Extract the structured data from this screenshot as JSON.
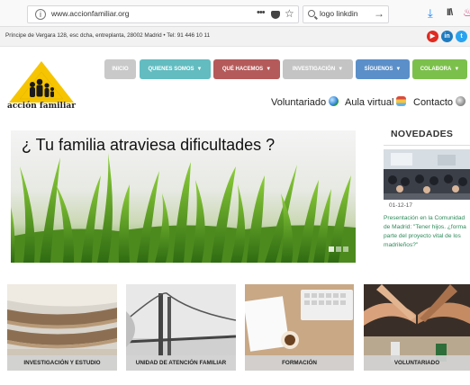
{
  "browser": {
    "url": "www.accionfamiliar.org",
    "more": "•••",
    "search_value": "logo linkdin",
    "go": "→",
    "download": "⤓",
    "library": "II\\",
    "ext": "♨"
  },
  "topbar": {
    "address": "Príncipe de Vergara 128, esc dcha, entreplanta, 28002 Madrid • Tel: 91 446 10 11",
    "social": [
      {
        "name": "youtube",
        "glyph": "▶",
        "color": "#e02a20"
      },
      {
        "name": "linkedin",
        "glyph": "in",
        "color": "#1f7bc0"
      },
      {
        "name": "twitter",
        "glyph": "t",
        "color": "#2aa3ef"
      }
    ]
  },
  "logo": {
    "text": "acción familiar",
    "color": "#f6c400"
  },
  "nav": [
    {
      "label": "INICIO",
      "color": "#c9c9c9",
      "has_caret": false
    },
    {
      "label": "QUIENES SOMOS",
      "color": "#62bcc0",
      "has_caret": true
    },
    {
      "label": "QUÉ HACEMOS",
      "color": "#b55a5a",
      "has_caret": true
    },
    {
      "label": "INVESTIGACIÓN",
      "color": "#c4c4c4",
      "has_caret": true
    },
    {
      "label": "SÍGUENOS",
      "color": "#5b8fc9",
      "has_caret": true
    },
    {
      "label": "COLABORA",
      "color": "#7cc04c",
      "has_caret": true
    }
  ],
  "sublinks": [
    {
      "label": "Voluntariado",
      "icon": "globe-icon"
    },
    {
      "label": "Aula virtual",
      "icon": "book-icon"
    },
    {
      "label": "Contacto",
      "icon": "contact-globe-icon"
    }
  ],
  "hero": {
    "title": "¿ Tu familia atraviesa dificultades ?",
    "slides": 3,
    "active_slide": 1
  },
  "novedades": {
    "heading": "NOVEDADES",
    "date": "01-12-17",
    "text": "Presentación en la Comunidad de Madrid: \"Tener hijos. ¿forma parte del proyecto vital de los madrileños?\""
  },
  "cards": [
    {
      "label": "INVESTIGACIÓN Y ESTUDIO"
    },
    {
      "label": "UNIDAD DE ATENCIÓN FAMILIAR"
    },
    {
      "label": "FORMACIÓN"
    },
    {
      "label": "VOLUNTARIADO"
    }
  ]
}
